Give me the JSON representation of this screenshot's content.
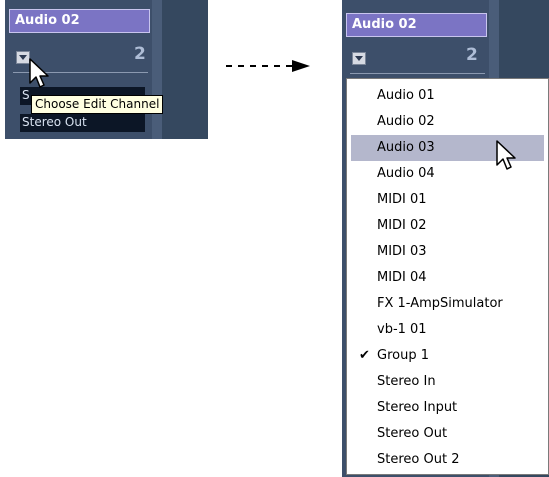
{
  "before": {
    "track_name": "Audio 02",
    "channel_number": "2",
    "output_labels": [
      "S",
      "Stereo Out"
    ],
    "tooltip": "Choose Edit Channel",
    "cursor_icon": "arrow-cursor-icon"
  },
  "after": {
    "track_name": "Audio 02",
    "channel_number": "2",
    "cursor_icon": "arrow-cursor-icon"
  },
  "menu": {
    "items": [
      {
        "label": "Audio 01",
        "checked": false,
        "highlighted": false
      },
      {
        "label": "Audio 02",
        "checked": false,
        "highlighted": false
      },
      {
        "label": "Audio 03",
        "checked": false,
        "highlighted": true
      },
      {
        "label": "Audio 04",
        "checked": false,
        "highlighted": false
      },
      {
        "label": "MIDI 01",
        "checked": false,
        "highlighted": false
      },
      {
        "label": "MIDI 02",
        "checked": false,
        "highlighted": false
      },
      {
        "label": "MIDI 03",
        "checked": false,
        "highlighted": false
      },
      {
        "label": "MIDI 04",
        "checked": false,
        "highlighted": false
      },
      {
        "label": "FX 1-AmpSimulator",
        "checked": false,
        "highlighted": false
      },
      {
        "label": "vb-1 01",
        "checked": false,
        "highlighted": false
      },
      {
        "label": "Group 1",
        "checked": true,
        "highlighted": false
      },
      {
        "label": "Stereo In",
        "checked": false,
        "highlighted": false
      },
      {
        "label": "Stereo Input",
        "checked": false,
        "highlighted": false
      },
      {
        "label": "Stereo Out",
        "checked": false,
        "highlighted": false
      },
      {
        "label": "Stereo Out 2",
        "checked": false,
        "highlighted": false
      }
    ],
    "check_glyph": "✔"
  },
  "colors": {
    "panel": "#3d4f6a",
    "title_bar": "#7b74c4",
    "menu_highlight": "#b4b7cc",
    "tooltip_bg": "#ffffe1"
  }
}
